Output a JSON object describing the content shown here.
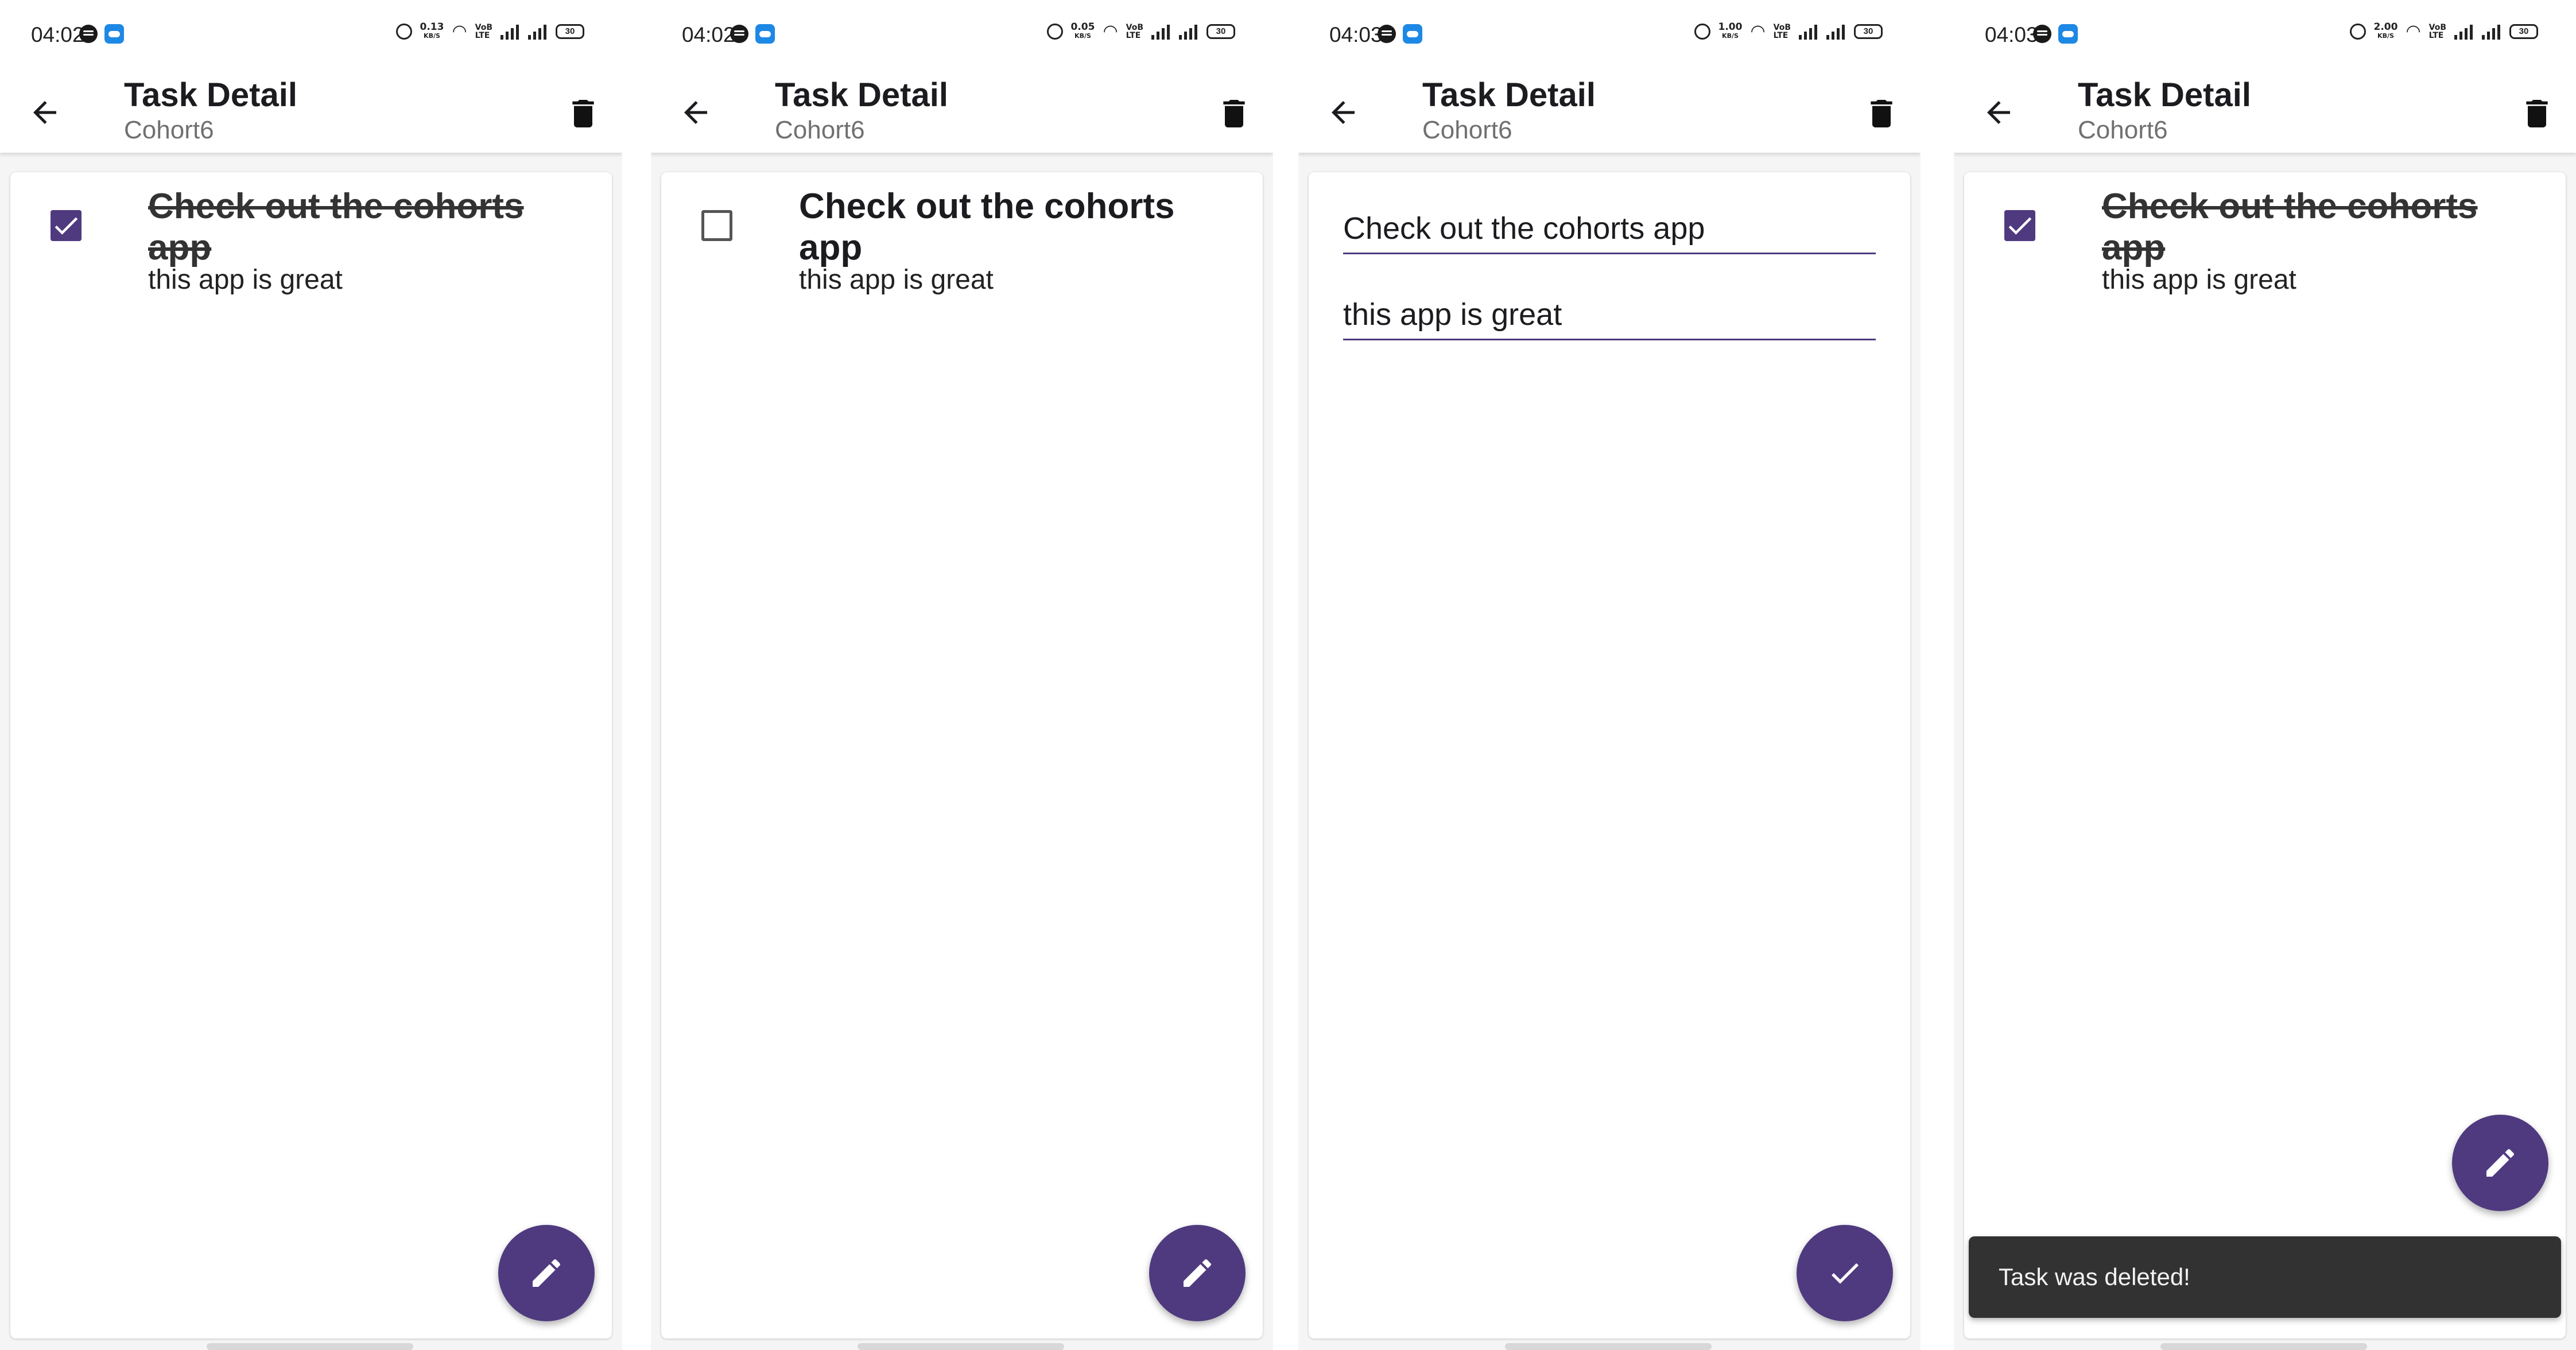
{
  "colors": {
    "accent": "#4f3a7f",
    "snackbar": "#323232"
  },
  "screens": [
    {
      "status": {
        "time": "04:02",
        "speed": "0.13",
        "speed_unit": "KB/S",
        "volte": "VoB",
        "lte": "LTE",
        "battery": "30"
      },
      "appbar": {
        "title": "Task Detail",
        "subtitle": "Cohort6"
      },
      "task": {
        "title": "Check out the cohorts app",
        "description": "this app is great",
        "completed": true
      },
      "fab_icon": "edit-icon"
    },
    {
      "status": {
        "time": "04:02",
        "speed": "0.05",
        "speed_unit": "KB/S",
        "volte": "VoB",
        "lte": "LTE",
        "battery": "30"
      },
      "appbar": {
        "title": "Task Detail",
        "subtitle": "Cohort6"
      },
      "task": {
        "title": "Check out the cohorts app",
        "description": "this app is great",
        "completed": false
      },
      "fab_icon": "edit-icon"
    },
    {
      "status": {
        "time": "04:03",
        "speed": "1.00",
        "speed_unit": "KB/S",
        "volte": "VoB",
        "lte": "LTE",
        "battery": "30"
      },
      "appbar": {
        "title": "Task Detail",
        "subtitle": "Cohort6"
      },
      "edit": {
        "title_value": "Check out the cohorts app",
        "description_value": "this app is great"
      },
      "fab_icon": "check-icon"
    },
    {
      "status": {
        "time": "04:03",
        "speed": "2.00",
        "speed_unit": "KB/S",
        "volte": "VoB",
        "lte": "LTE",
        "battery": "30"
      },
      "appbar": {
        "title": "Task Detail",
        "subtitle": "Cohort6"
      },
      "task": {
        "title": "Check out the cohorts app",
        "description": "this app is great",
        "completed": true
      },
      "fab_icon": "edit-icon",
      "snackbar": {
        "message": "Task was deleted!"
      }
    }
  ]
}
